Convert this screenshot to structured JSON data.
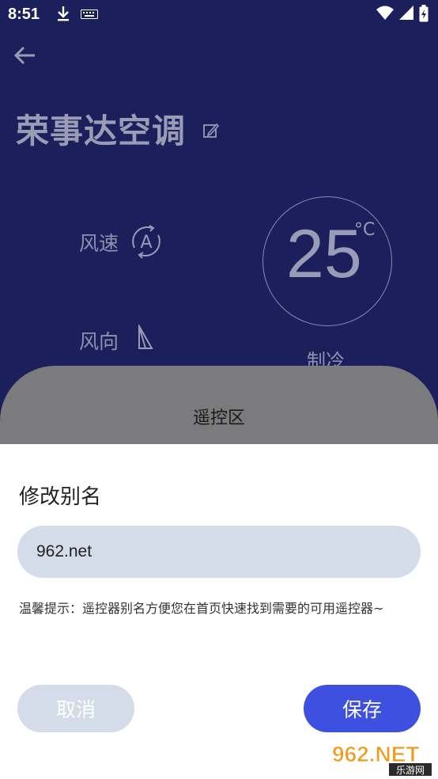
{
  "status_bar": {
    "time": "8:51"
  },
  "device": {
    "title": "荣事达空调"
  },
  "controls": {
    "wind_speed_label": "风速",
    "wind_speed_icon_letter": "A",
    "wind_direction_label": "风向",
    "temperature": "25",
    "temperature_unit": "°C",
    "mode": "制冷"
  },
  "remote_panel": {
    "title": "遥控区"
  },
  "dialog": {
    "title": "修改别名",
    "input_value": "962.net",
    "hint": "温馨提示：遥控器别名方便您在首页快速找到需要的可用遥控器~",
    "cancel_label": "取消",
    "save_label": "保存"
  },
  "watermark": {
    "brand": "962.NET",
    "sub": "乐游网"
  },
  "colors": {
    "background": "#1b1f5c",
    "panel": "#7b7b7d",
    "input_bg": "#d4dce9",
    "save_button": "#3e50e0"
  }
}
